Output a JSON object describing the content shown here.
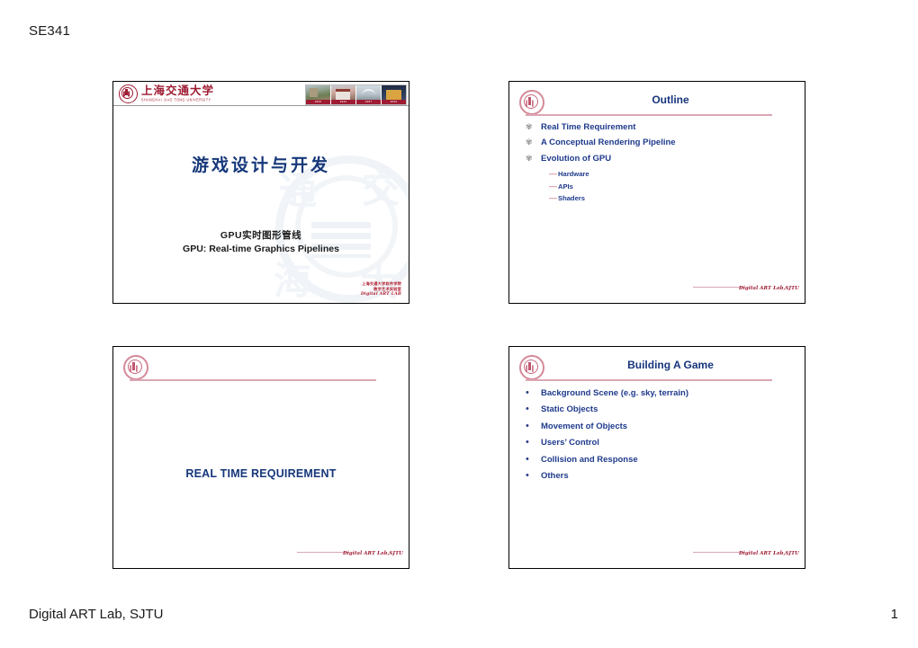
{
  "page": {
    "header_label": "SE341",
    "footer_left": "Digital ART Lab, SJTU",
    "footer_page_number": "1"
  },
  "colors": {
    "heading_navy": "#17357c",
    "bullet_navy": "#1e3a8c",
    "rule_pink": "#dba7b4",
    "brand_red": "#9e1b32",
    "watermark_blue": "#e4eaf2"
  },
  "slides": [
    {
      "id": "slide-1",
      "kind": "title",
      "banner": {
        "university_cn": "上海交通大学",
        "university_en": "SHANGHAI JIAO TONG UNIVERSITY",
        "photo_years": [
          "1896",
          "1920",
          "1987",
          "2006"
        ]
      },
      "title_cn": "游戏设计与开发",
      "subtitle_cn": "GPU实时图形管线",
      "subtitle_en": "GPU: Real-time Graphics Pipelines",
      "credit_lines": [
        "上海交通大学软件学院",
        "数字艺术实验室",
        "Digital ART LAB"
      ]
    },
    {
      "id": "slide-2",
      "kind": "content",
      "title": "Outline",
      "bullets": [
        {
          "marker": "flower",
          "text": "Real Time Requirement",
          "subitems": []
        },
        {
          "marker": "flower",
          "text": "A Conceptual Rendering Pipeline",
          "subitems": []
        },
        {
          "marker": "flower",
          "text": "Evolution of GPU",
          "subitems": [
            "Hardware",
            "APIs",
            "Shaders"
          ]
        }
      ],
      "footer": "Digital ART Lab,SJTU"
    },
    {
      "id": "slide-3",
      "kind": "section",
      "title": "",
      "section_heading": "REAL TIME REQUIREMENT",
      "footer": "Digital ART Lab,SJTU"
    },
    {
      "id": "slide-4",
      "kind": "content",
      "title": "Building A Game",
      "bullets": [
        {
          "marker": "dot",
          "text": "Background Scene (e.g. sky, terrain)",
          "subitems": []
        },
        {
          "marker": "dot",
          "text": "Static Objects",
          "subitems": []
        },
        {
          "marker": "dot",
          "text": "Movement of Objects",
          "subitems": []
        },
        {
          "marker": "dot",
          "text": "Users’ Control",
          "subitems": []
        },
        {
          "marker": "dot",
          "text": "Collision and Response",
          "subitems": []
        },
        {
          "marker": "dot",
          "text": "Others",
          "subitems": []
        }
      ],
      "footer": "Digital ART Lab,SJTU"
    }
  ],
  "markers": {
    "flower": "✾",
    "dot": "•",
    "dash": "—"
  }
}
